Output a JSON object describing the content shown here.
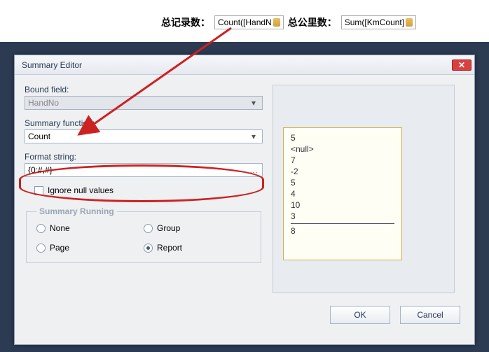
{
  "designer": {
    "label_records": "总记录数：",
    "expr1": "Count([HandN",
    "label_km": "总公里数：",
    "expr2": "Sum([KmCount]"
  },
  "dialog": {
    "title": "Summary Editor",
    "bound_field_label": "Bound field:",
    "bound_field_value": "HandNo",
    "summary_func_label": "Summary function:",
    "summary_func_value": "Count",
    "format_string_label": "Format string:",
    "format_string_value": "{0:#,#}",
    "ignore_nulls": "Ignore null values",
    "running_legend": "Summary Running",
    "radio_none": "None",
    "radio_group": "Group",
    "radio_page": "Page",
    "radio_report": "Report",
    "ok": "OK",
    "cancel": "Cancel"
  },
  "preview": {
    "line1": "5",
    "line2": "<null>",
    "line3": "7",
    "line4": "-2",
    "line5": "5",
    "line6": "4",
    "line7": "10",
    "line8": "3",
    "result": "8"
  }
}
